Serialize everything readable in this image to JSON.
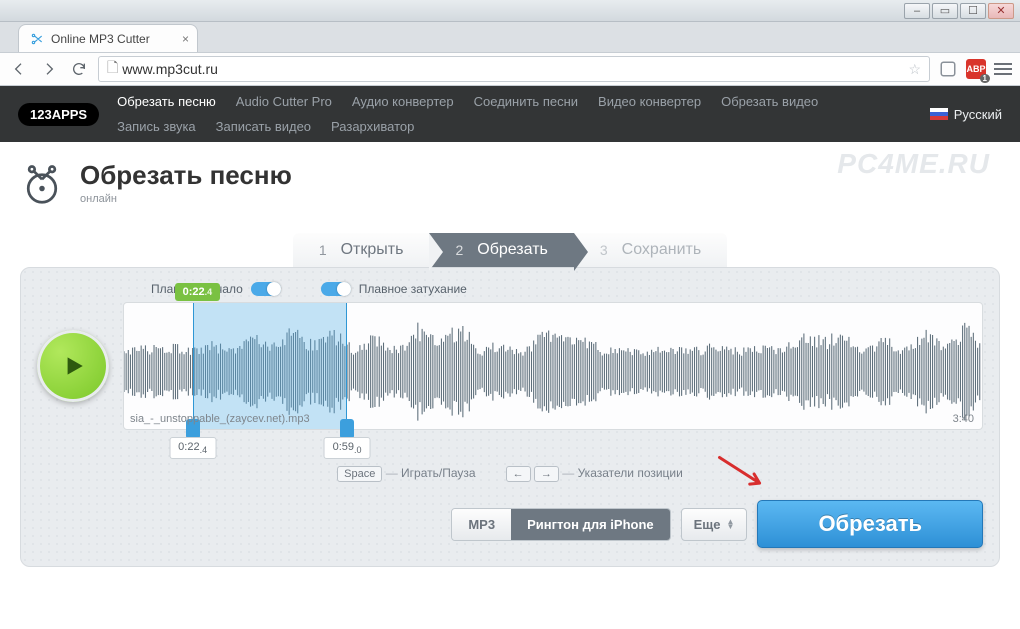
{
  "browser": {
    "tab_title": "Online MP3 Cutter",
    "url": "www.mp3cut.ru",
    "abp_label": "ABP"
  },
  "nav": {
    "brand": "123APPS",
    "items": [
      {
        "label": "Обрезать песню",
        "active": true
      },
      {
        "label": "Audio Cutter Pro"
      },
      {
        "label": "Аудио конвертер"
      },
      {
        "label": "Соединить песни"
      },
      {
        "label": "Видео конвертер"
      },
      {
        "label": "Обрезать видео"
      },
      {
        "label": "Запись звука"
      },
      {
        "label": "Записать видео"
      },
      {
        "label": "Разархиватор"
      }
    ],
    "language": "Русский"
  },
  "page": {
    "watermark": "PC4ME.RU",
    "title": "Обрезать песню",
    "subtitle": "онлайн"
  },
  "steps": [
    {
      "num": "1",
      "label": "Открыть"
    },
    {
      "num": "2",
      "label": "Обрезать"
    },
    {
      "num": "3",
      "label": "Сохранить"
    }
  ],
  "toggles": {
    "fade_in": "Плавное начало",
    "fade_out": "Плавное затухание"
  },
  "wave": {
    "filename": "sia_-_unstoppable_(zaycev.net).mp3",
    "duration": "3:40",
    "cursor_main": "0:22",
    "cursor_frac": ".4",
    "marker_start": "0:22",
    "marker_start_frac": ".4",
    "marker_end": "0:59",
    "marker_end_frac": ".0",
    "selection_left_pct": 8,
    "selection_right_pct": 26
  },
  "hints": {
    "key_space": "Space",
    "space_label": "Играть/Пауза",
    "key_left": "←",
    "key_right": "→",
    "arrows_label": "Указатели позиции"
  },
  "format": {
    "mp3": "MP3",
    "ringtone": "Рингтон для iPhone",
    "more": "Еще"
  },
  "cta": "Обрезать"
}
